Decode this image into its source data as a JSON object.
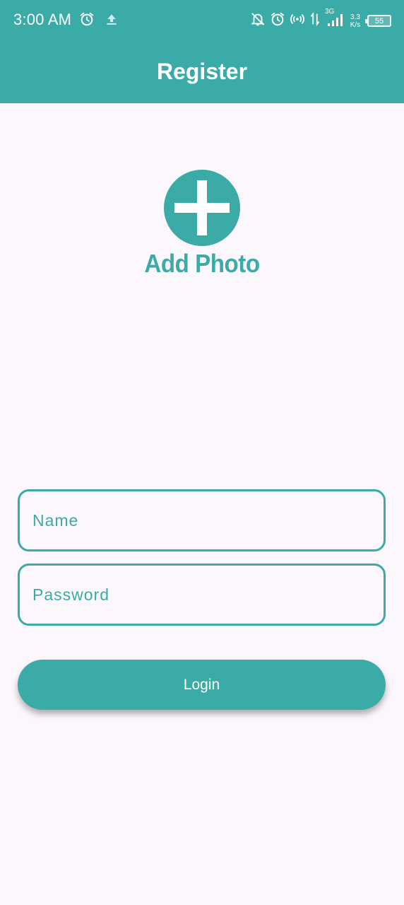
{
  "status_bar": {
    "time": "3:00 AM",
    "net_speed_value": "3.3",
    "net_speed_unit": "K/s",
    "network_type": "3G",
    "battery_level": "55",
    "left_icons": [
      "alarm-icon",
      "upload-icon"
    ],
    "right_icons": [
      "notifications-off-icon",
      "alarm-icon",
      "hotspot-icon",
      "data-transfer-icon",
      "signal-3g-icon",
      "battery-icon"
    ]
  },
  "app_bar": {
    "title": "Register"
  },
  "add_photo": {
    "label": "Add Photo",
    "icon": "plus-icon"
  },
  "form": {
    "name_placeholder": "Name",
    "name_value": "",
    "password_placeholder": "Password",
    "password_value": "",
    "login_label": "Login"
  },
  "colors": {
    "primary": "#3AABA6",
    "background": "#FCF7FD",
    "on_primary": "#FFFFFF"
  }
}
